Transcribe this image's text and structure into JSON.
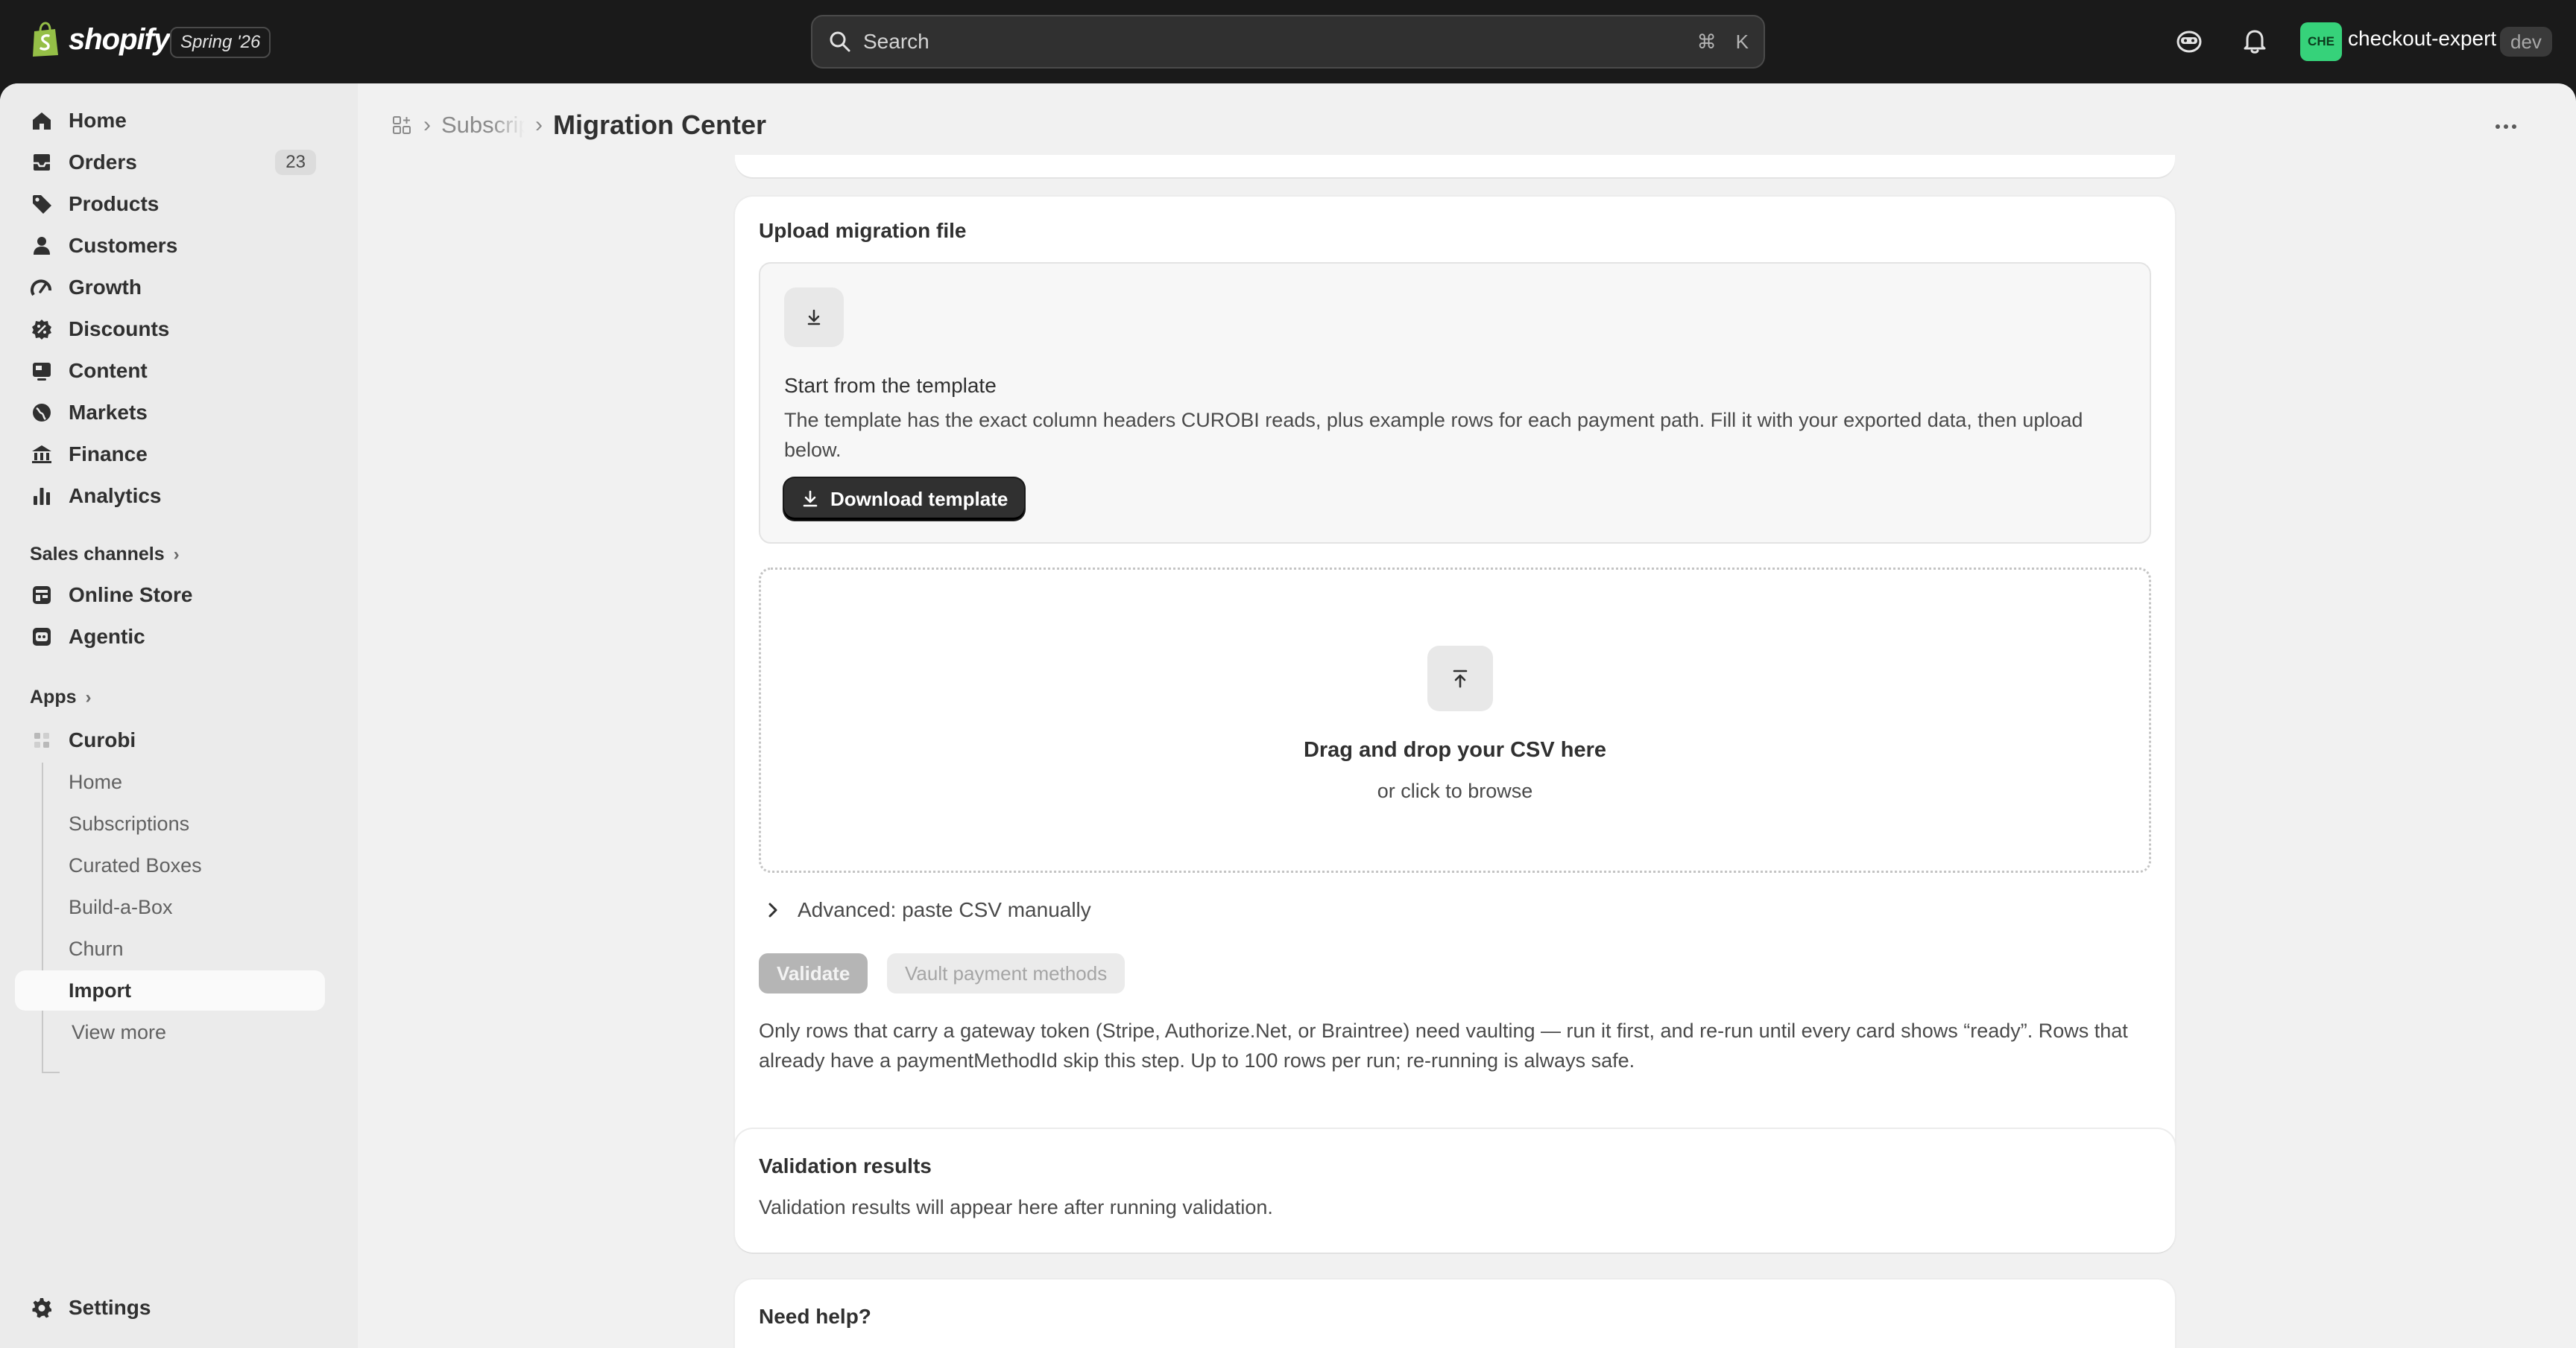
{
  "topbar": {
    "logo_text": "shopify",
    "version": "Spring '26",
    "search_placeholder": "Search",
    "kbd_cmd": "⌘",
    "kbd_key": "K",
    "avatar_initials": "CHE",
    "store_name": "checkout-expert",
    "env_badge": "dev"
  },
  "sidebar": {
    "items": [
      {
        "label": "Home",
        "icon": "home-icon"
      },
      {
        "label": "Orders",
        "icon": "orders-icon",
        "badge": "23"
      },
      {
        "label": "Products",
        "icon": "tag-icon"
      },
      {
        "label": "Customers",
        "icon": "person-icon"
      },
      {
        "label": "Growth",
        "icon": "growth-icon"
      },
      {
        "label": "Discounts",
        "icon": "discount-icon"
      },
      {
        "label": "Content",
        "icon": "content-icon"
      },
      {
        "label": "Markets",
        "icon": "globe-icon"
      },
      {
        "label": "Finance",
        "icon": "bank-icon"
      },
      {
        "label": "Analytics",
        "icon": "bar-chart-icon"
      }
    ],
    "sales_channels_label": "Sales channels",
    "sales_channels": [
      {
        "label": "Online Store",
        "icon": "store-icon"
      },
      {
        "label": "Agentic",
        "icon": "agentic-icon"
      }
    ],
    "apps_label": "Apps",
    "app_name": "Curobi",
    "app_subitems": [
      "Home",
      "Subscriptions",
      "Curated Boxes",
      "Build-a-Box",
      "Churn",
      "Import"
    ],
    "active_subitem": "Import",
    "view_more": "View more",
    "settings_label": "Settings"
  },
  "header": {
    "breadcrumb": "Subscriptions",
    "title": "Migration Center"
  },
  "upload_card": {
    "title": "Upload migration file",
    "template_heading": "Start from the template",
    "template_desc": "The template has the exact column headers CUROBI reads, plus example rows for each payment path. Fill it with your exported data, then upload below.",
    "download_label": "Download template",
    "dropzone_title": "Drag and drop your CSV here",
    "dropzone_sub": "or click to browse",
    "advanced_label": "Advanced: paste CSV manually",
    "validate_label": "Validate",
    "vault_label": "Vault payment methods",
    "note": "Only rows that carry a gateway token (Stripe, Authorize.Net, or Braintree) need vaulting — run it first, and re-run until every card shows “ready”. Rows that already have a paymentMethodId skip this step. Up to 100 rows per run; re-running is always safe."
  },
  "validation_card": {
    "title": "Validation results",
    "body": "Validation results will appear here after running validation."
  },
  "help_card": {
    "title": "Need help?"
  },
  "colors": {
    "topbar_bg": "#1a1a1a",
    "frame_bg": "#f1f1f1",
    "sidebar_bg": "#ebebeb",
    "avatar_bg": "#36d27a",
    "primary_button": "#303030"
  }
}
